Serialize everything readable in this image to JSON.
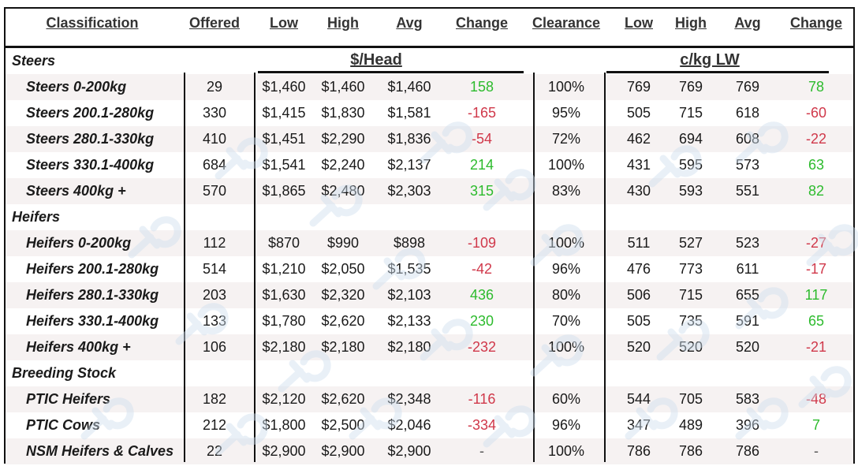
{
  "header": {
    "columns": [
      "Classification",
      "Offered",
      "Low",
      "High",
      "Avg",
      "Change",
      "Clearance",
      "Low",
      "High",
      "Avg",
      "Change"
    ]
  },
  "units": {
    "per_head": "$/Head",
    "per_kg": "c/kg LW"
  },
  "colors": {
    "positive": "#2dbb2d",
    "negative": "#d0384a",
    "row_shade": "#f6f2f2",
    "watermark": "#cfe0ef"
  },
  "watermark_icon": "logo-watermark-icon",
  "sections": [
    {
      "title": "Steers",
      "rows": [
        {
          "classification": "Steers 0-200kg",
          "offered": "29",
          "low": "$1,460",
          "high": "$1,460",
          "avg": "$1,460",
          "change": "158",
          "change_sign": "pos",
          "clearance": "100%",
          "kg_low": "769",
          "kg_high": "769",
          "kg_avg": "769",
          "kg_change": "78",
          "kg_change_sign": "pos"
        },
        {
          "classification": "Steers 200.1-280kg",
          "offered": "330",
          "low": "$1,415",
          "high": "$1,830",
          "avg": "$1,581",
          "change": "-165",
          "change_sign": "neg",
          "clearance": "95%",
          "kg_low": "505",
          "kg_high": "715",
          "kg_avg": "618",
          "kg_change": "-60",
          "kg_change_sign": "neg"
        },
        {
          "classification": "Steers 280.1-330kg",
          "offered": "410",
          "low": "$1,451",
          "high": "$2,290",
          "avg": "$1,836",
          "change": "-54",
          "change_sign": "neg",
          "clearance": "72%",
          "kg_low": "462",
          "kg_high": "694",
          "kg_avg": "608",
          "kg_change": "-22",
          "kg_change_sign": "neg"
        },
        {
          "classification": "Steers 330.1-400kg",
          "offered": "684",
          "low": "$1,541",
          "high": "$2,240",
          "avg": "$2,137",
          "change": "214",
          "change_sign": "pos",
          "clearance": "100%",
          "kg_low": "431",
          "kg_high": "595",
          "kg_avg": "573",
          "kg_change": "63",
          "kg_change_sign": "pos"
        },
        {
          "classification": "Steers 400kg +",
          "offered": "570",
          "low": "$1,865",
          "high": "$2,480",
          "avg": "$2,303",
          "change": "315",
          "change_sign": "pos",
          "clearance": "83%",
          "kg_low": "430",
          "kg_high": "593",
          "kg_avg": "551",
          "kg_change": "82",
          "kg_change_sign": "pos"
        }
      ]
    },
    {
      "title": "Heifers",
      "rows": [
        {
          "classification": "Heifers 0-200kg",
          "offered": "112",
          "low": "$870",
          "high": "$990",
          "avg": "$898",
          "change": "-109",
          "change_sign": "neg",
          "clearance": "100%",
          "kg_low": "511",
          "kg_high": "527",
          "kg_avg": "523",
          "kg_change": "-27",
          "kg_change_sign": "neg"
        },
        {
          "classification": "Heifers 200.1-280kg",
          "offered": "514",
          "low": "$1,210",
          "high": "$2,050",
          "avg": "$1,535",
          "change": "-42",
          "change_sign": "neg",
          "clearance": "96%",
          "kg_low": "476",
          "kg_high": "773",
          "kg_avg": "611",
          "kg_change": "-17",
          "kg_change_sign": "neg"
        },
        {
          "classification": "Heifers 280.1-330kg",
          "offered": "203",
          "low": "$1,630",
          "high": "$2,320",
          "avg": "$2,103",
          "change": "436",
          "change_sign": "pos",
          "clearance": "80%",
          "kg_low": "506",
          "kg_high": "715",
          "kg_avg": "655",
          "kg_change": "117",
          "kg_change_sign": "pos"
        },
        {
          "classification": "Heifers 330.1-400kg",
          "offered": "133",
          "low": "$1,780",
          "high": "$2,620",
          "avg": "$2,133",
          "change": "230",
          "change_sign": "pos",
          "clearance": "70%",
          "kg_low": "505",
          "kg_high": "735",
          "kg_avg": "591",
          "kg_change": "65",
          "kg_change_sign": "pos"
        },
        {
          "classification": "Heifers 400kg +",
          "offered": "106",
          "low": "$2,180",
          "high": "$2,180",
          "avg": "$2,180",
          "change": "-232",
          "change_sign": "neg",
          "clearance": "100%",
          "kg_low": "520",
          "kg_high": "520",
          "kg_avg": "520",
          "kg_change": "-21",
          "kg_change_sign": "neg"
        }
      ]
    },
    {
      "title": "Breeding Stock",
      "rows": [
        {
          "classification": "PTIC Heifers",
          "offered": "182",
          "low": "$2,120",
          "high": "$2,620",
          "avg": "$2,348",
          "change": "-116",
          "change_sign": "neg",
          "clearance": "60%",
          "kg_low": "544",
          "kg_high": "705",
          "kg_avg": "583",
          "kg_change": "-48",
          "kg_change_sign": "neg"
        },
        {
          "classification": "PTIC Cows",
          "offered": "212",
          "low": "$1,800",
          "high": "$2,500",
          "avg": "$2,046",
          "change": "-334",
          "change_sign": "neg",
          "clearance": "96%",
          "kg_low": "347",
          "kg_high": "489",
          "kg_avg": "396",
          "kg_change": "7",
          "kg_change_sign": "pos"
        },
        {
          "classification": "NSM Heifers & Calves",
          "offered": "22",
          "low": "$2,900",
          "high": "$2,900",
          "avg": "$2,900",
          "change": "-",
          "change_sign": "dash",
          "clearance": "100%",
          "kg_low": "786",
          "kg_high": "786",
          "kg_avg": "786",
          "kg_change": "-",
          "kg_change_sign": "dash"
        }
      ]
    }
  ]
}
